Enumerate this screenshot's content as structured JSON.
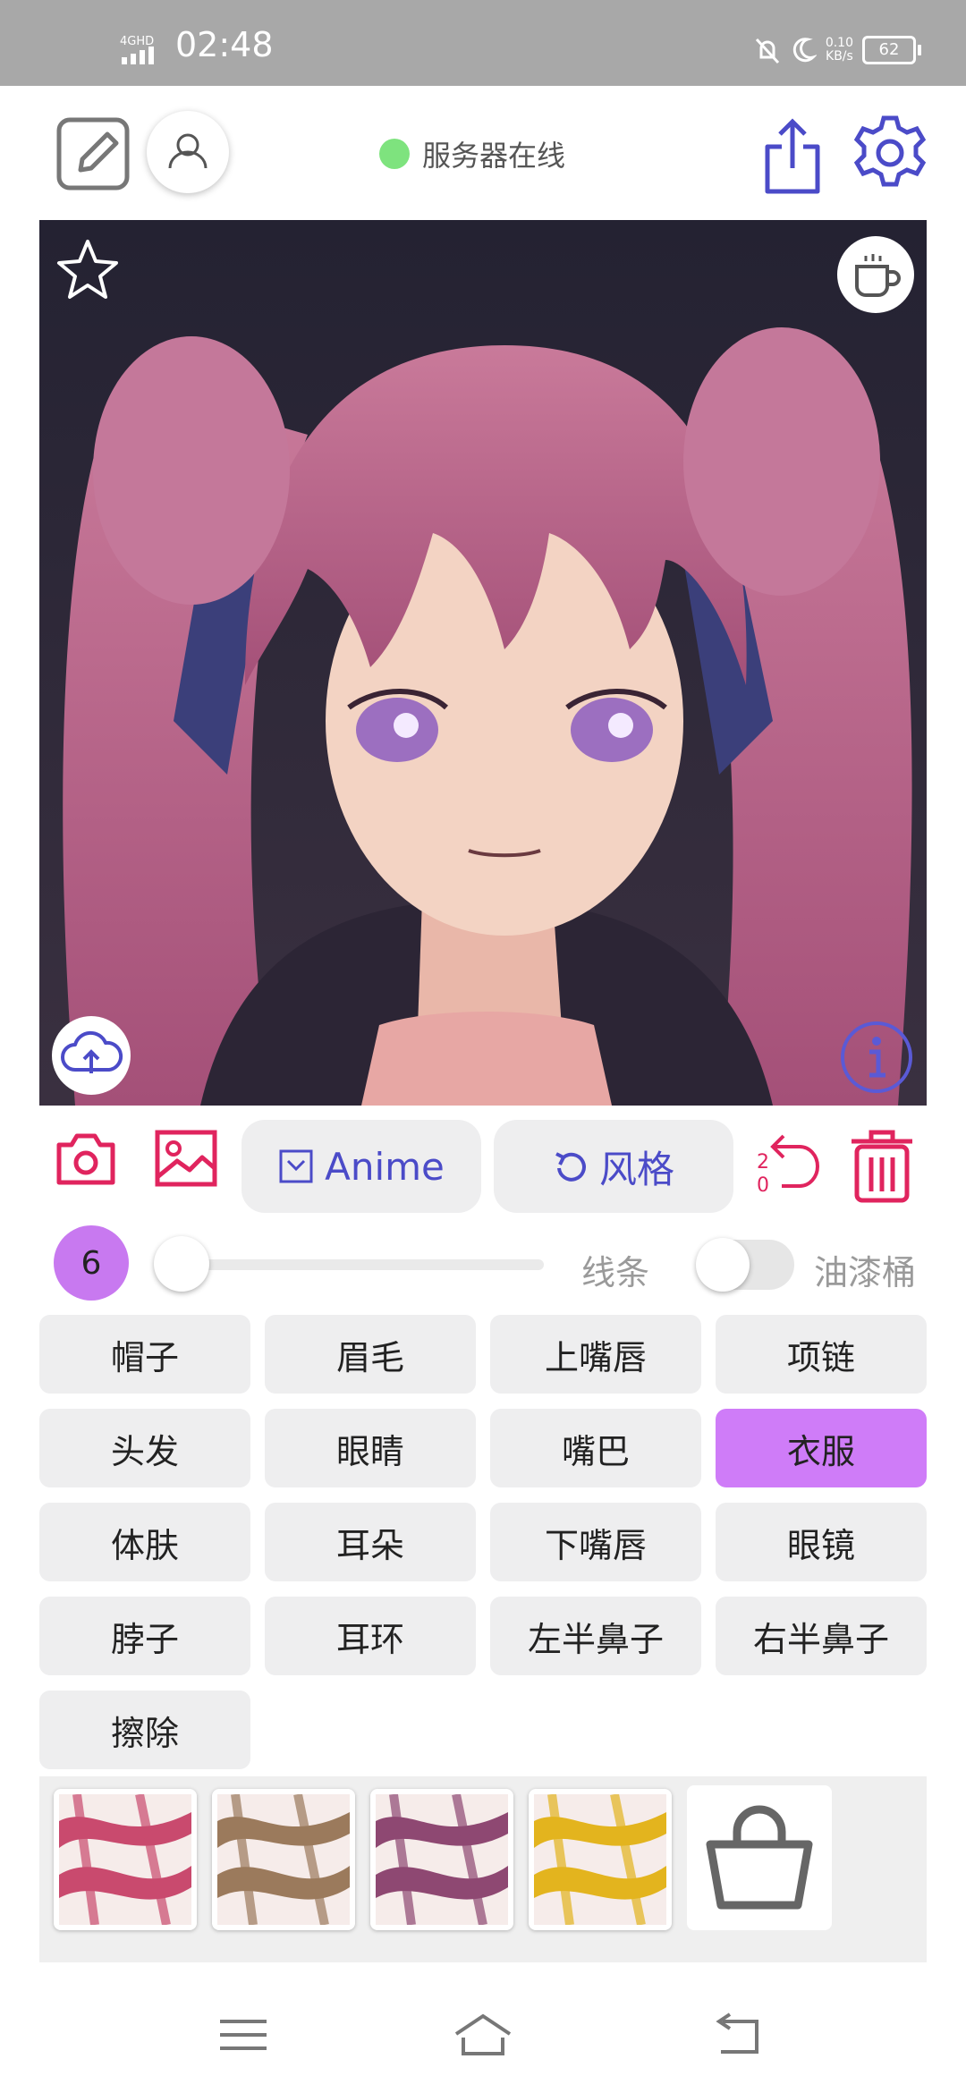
{
  "status_bar": {
    "network": "4GHD",
    "time": "02:48",
    "speed_value": "0.10",
    "speed_unit": "KB/s",
    "battery": "62"
  },
  "header": {
    "server_status": "服务器在线",
    "server_dot_color": "#7ee37e",
    "icons": [
      "edit-icon",
      "user-icon",
      "share-icon",
      "settings-icon"
    ]
  },
  "canvas": {
    "overlay_icons": [
      "star-icon",
      "coffee-icon",
      "cloud-upload-icon",
      "info-icon"
    ]
  },
  "actions": {
    "anime_label": "Anime",
    "style_label": "风格",
    "undo_count_top": "2",
    "undo_count_bottom": "0",
    "accent_color": "#4b4bc8",
    "danger_color": "#e0245e"
  },
  "brush": {
    "size": "6",
    "slider_level": 0.0,
    "line_label": "线条",
    "bucket_label": "油漆桶",
    "bucket_enabled": false
  },
  "labels": [
    {
      "text": "帽子",
      "selected": false
    },
    {
      "text": "眉毛",
      "selected": false
    },
    {
      "text": "上嘴唇",
      "selected": false
    },
    {
      "text": "项链",
      "selected": false
    },
    {
      "text": "头发",
      "selected": false
    },
    {
      "text": "眼睛",
      "selected": false
    },
    {
      "text": "嘴巴",
      "selected": false
    },
    {
      "text": "衣服",
      "selected": true
    },
    {
      "text": "体肤",
      "selected": false
    },
    {
      "text": "耳朵",
      "selected": false
    },
    {
      "text": "下嘴唇",
      "selected": false
    },
    {
      "text": "眼镜",
      "selected": false
    },
    {
      "text": "脖子",
      "selected": false
    },
    {
      "text": "耳环",
      "selected": false
    },
    {
      "text": "左半鼻子",
      "selected": false
    },
    {
      "text": "右半鼻子",
      "selected": false
    },
    {
      "text": "擦除",
      "selected": false
    }
  ],
  "palette": {
    "swatch_colors": [
      "#c94a6e",
      "#9b7a5c",
      "#8e4872",
      "#e3b41e"
    ],
    "store_icon": "shopping-bag-icon"
  },
  "nav": {
    "icons": [
      "menu-icon",
      "home-icon",
      "back-icon"
    ]
  }
}
